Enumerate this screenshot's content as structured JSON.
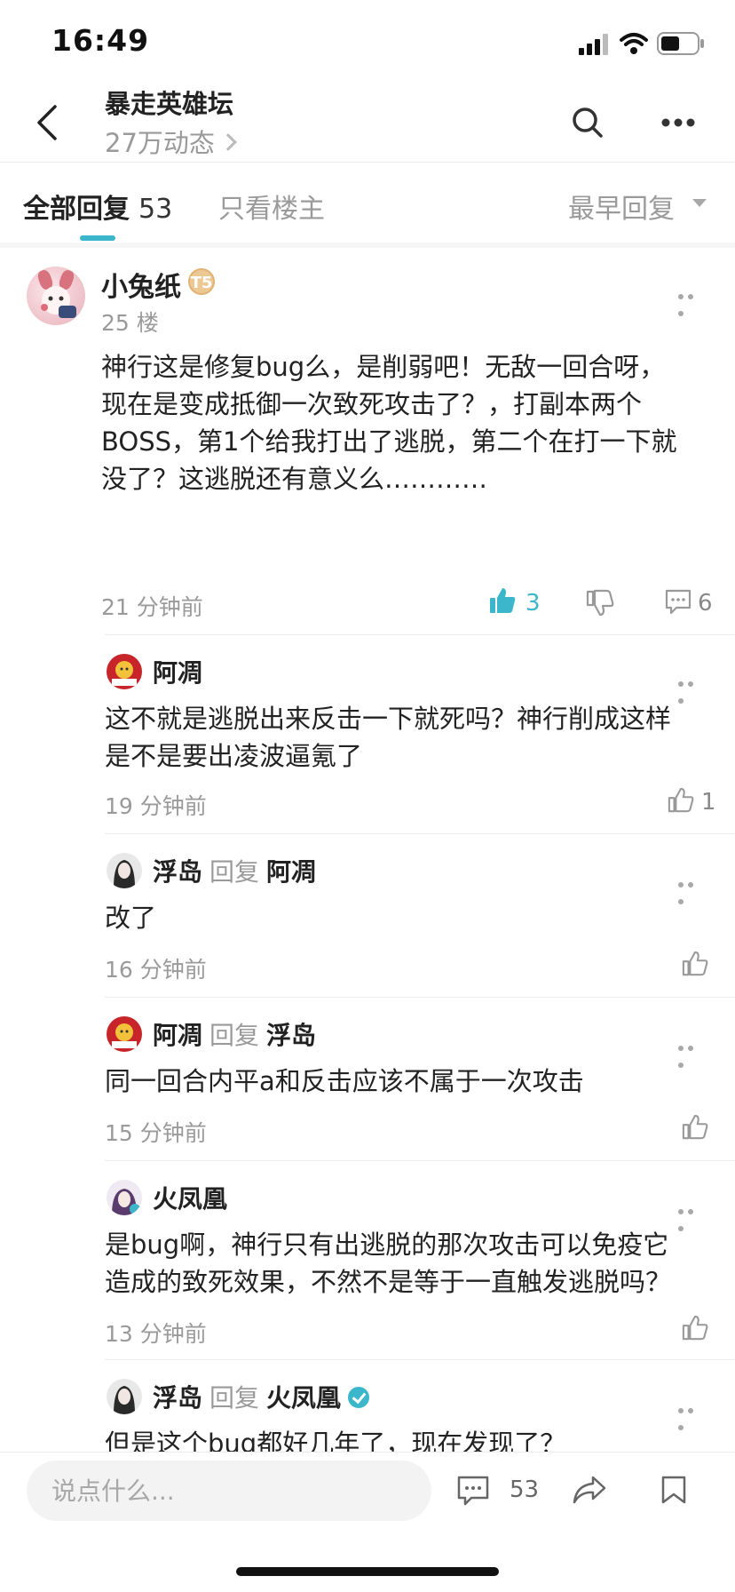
{
  "status_bar": {
    "time": "16:49"
  },
  "header": {
    "title": "暴走英雄坛",
    "subtitle": "27万动态"
  },
  "tabs": {
    "all_label": "全部回复",
    "all_count": "53",
    "op_only_label": "只看楼主",
    "sort_label": "最早回复"
  },
  "main_post": {
    "author": "小兔纸",
    "level_badge": "T5",
    "floor": "25 楼",
    "content": "神行这是修复bug么，是削弱吧！无敌一回合呀，\n现在是变成抵御一次致死攻击了？，打副本两个\nBOSS，第1个给我打出了逃脱，第二个在打一下就\n没了？这逃脱还有意义么…………",
    "time": "21 分钟前",
    "likes": "3",
    "comments": "6"
  },
  "replies": [
    {
      "author": "阿凋",
      "reply_to": "",
      "content": "这不就是逃脱出来反击一下就死吗？神行削成这样\n是不是要出凌波逼氪了",
      "time": "19 分钟前",
      "likes": "1"
    },
    {
      "author": "浮岛",
      "reply_word": "回复",
      "reply_to": "阿凋",
      "content": "改了",
      "time": "16 分钟前",
      "likes": ""
    },
    {
      "author": "阿凋",
      "reply_word": "回复",
      "reply_to": "浮岛",
      "content": "同一回合内平a和反击应该不属于一次攻击",
      "time": "15 分钟前",
      "likes": ""
    },
    {
      "author": "火凤凰",
      "reply_to": "",
      "content": "是bug啊，神行只有出逃脱的那次攻击可以免疫它\n造成的致死效果，不然不是等于一直触发逃脱吗？",
      "time": "13 分钟前",
      "likes": ""
    },
    {
      "author": "浮岛",
      "reply_word": "回复",
      "reply_to": "火凤凰",
      "content": "但是这个bug都好几年了，现在发现了？",
      "time": "",
      "likes": ""
    }
  ],
  "bottom_bar": {
    "input_placeholder": "说点什么...",
    "comment_count": "53"
  },
  "colors": {
    "accent": "#3bb6cb",
    "muted_text": "#9a9a9a",
    "divider": "#ececec"
  }
}
